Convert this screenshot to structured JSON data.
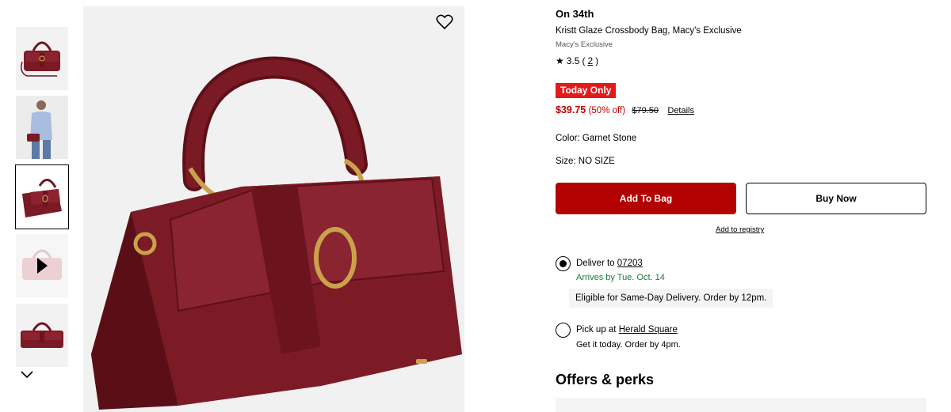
{
  "thumbnails": [
    {
      "name": "thumbnail-bag-front",
      "selected": false
    },
    {
      "name": "thumbnail-model",
      "selected": false
    },
    {
      "name": "thumbnail-bag-angle",
      "selected": true
    },
    {
      "name": "thumbnail-video",
      "selected": false
    },
    {
      "name": "thumbnail-bag-flat",
      "selected": false
    }
  ],
  "product": {
    "brand": "On 34th",
    "title": "Kristt Glaze Crossbody Bag, Macy's Exclusive",
    "exclusive": "Macy's Exclusive",
    "rating": "3.5",
    "review_count": "2",
    "badge": "Today Only",
    "sale_price": "$39.75",
    "discount": "(50% off)",
    "original_price": "$79.50",
    "details_link": "Details",
    "color_label": "Color:",
    "color_value": "Garnet Stone",
    "size_label": "Size:",
    "size_value": "NO SIZE"
  },
  "actions": {
    "add_to_bag": "Add To Bag",
    "buy_now": "Buy Now",
    "registry": "Add to registry"
  },
  "fulfillment": {
    "deliver_prefix": "Deliver to",
    "zip": "07203",
    "arrives": "Arrives by Tue. Oct. 14",
    "same_day": "Eligible for Same-Day Delivery. Order by 12pm.",
    "pickup_prefix": "Pick up at",
    "store": "Herald Square",
    "pickup_note": "Get it today. Order by 4pm.",
    "selected": "deliver"
  },
  "offers": {
    "heading": "Offers & perks"
  },
  "colors": {
    "sale_red": "#c40000",
    "badge_red": "#e21a1a",
    "button_red": "#b30000",
    "arrival_green": "#1a7a3a",
    "bag_burgundy": "#7a1a24"
  },
  "icons": [
    "heart-icon",
    "star-icon",
    "chevron-down-icon",
    "play-icon",
    "radio-checked-icon",
    "radio-unchecked-icon"
  ]
}
